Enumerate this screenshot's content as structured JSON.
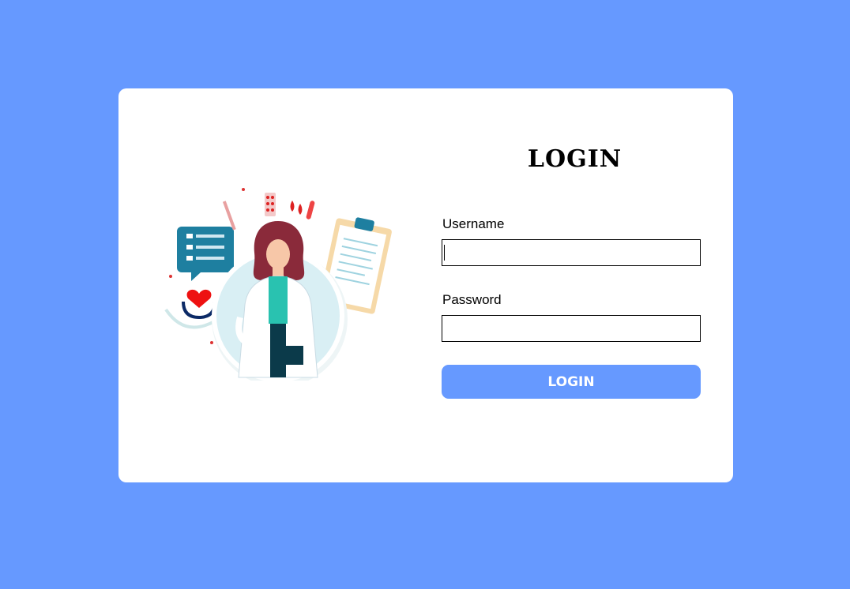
{
  "form": {
    "title": "LOGIN",
    "username_label": "Username",
    "username_value": "",
    "password_label": "Password",
    "password_value": "",
    "submit_label": "LOGIN"
  },
  "illustration": {
    "icon": "doctor-medical-icon"
  },
  "colors": {
    "background": "#6699ff",
    "card": "#ffffff",
    "button": "#6699ff"
  }
}
